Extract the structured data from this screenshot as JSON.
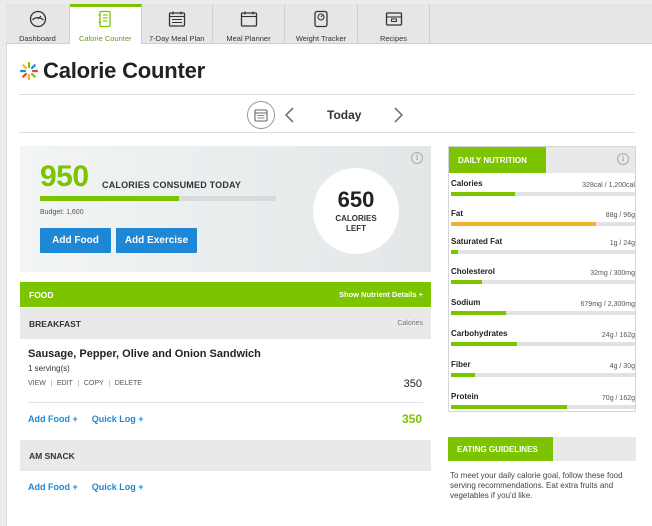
{
  "tabs": [
    {
      "label": "Dashboard",
      "icon": "dashboard-icon"
    },
    {
      "label": "Calorie Counter",
      "icon": "notebook-icon"
    },
    {
      "label": "7-Day Meal Plan",
      "icon": "calendar-week-icon"
    },
    {
      "label": "Meal Planner",
      "icon": "calendar-icon"
    },
    {
      "label": "Weight Tracker",
      "icon": "scale-icon"
    },
    {
      "label": "Recipes",
      "icon": "recipe-box-icon"
    }
  ],
  "active_tab": "Calorie Counter",
  "page": {
    "title": "Calorie Counter"
  },
  "date_nav": {
    "label": "Today"
  },
  "summary": {
    "consumed": "950",
    "consumed_label": "CALORIES CONSUMED TODAY",
    "budget": "Budget: 1,600",
    "left": "650",
    "left_label": "CALORIES LEFT",
    "progress_fraction": 0.59,
    "add_food": "Add Food",
    "add_exercise": "Add Exercise"
  },
  "food": {
    "header": "FOOD",
    "show_details": "Show Nutrient Details +",
    "breakfast": {
      "title": "BREAKFAST",
      "calories_header": "Calories",
      "item": {
        "name": "Sausage, Pepper, Olive and Onion Sandwich",
        "serving": "1 serving(s)",
        "actions": [
          "VIEW",
          "EDIT",
          "COPY",
          "DELETE"
        ],
        "calories": "350"
      },
      "add_food": "Add Food +",
      "quick_log": "Quick Log +",
      "total": "350"
    },
    "snack": {
      "title": "AM SNACK",
      "add_food": "Add Food +",
      "quick_log": "Quick Log +"
    }
  },
  "nutrition": {
    "header": "DAILY NUTRITION",
    "rows": [
      {
        "name": "Calories",
        "value": "328cal / 1,200cal",
        "fraction": 0.35,
        "color": "#7cc400"
      },
      {
        "name": "Fat",
        "value": "88g / 96g",
        "fraction": 0.79,
        "color": "#f0b323"
      },
      {
        "name": "Saturated Fat",
        "value": "1g / 24g",
        "fraction": 0.04,
        "color": "#7cc400"
      },
      {
        "name": "Cholesterol",
        "value": "32mg / 300mg",
        "fraction": 0.17,
        "color": "#7cc400"
      },
      {
        "name": "Sodium",
        "value": "679mg / 2,300mg",
        "fraction": 0.3,
        "color": "#7cc400"
      },
      {
        "name": "Carbohydrates",
        "value": "24g / 162g",
        "fraction": 0.36,
        "color": "#7cc400"
      },
      {
        "name": "Fiber",
        "value": "4g / 30g",
        "fraction": 0.13,
        "color": "#7cc400"
      },
      {
        "name": "Protein",
        "value": "70g / 162g",
        "fraction": 0.63,
        "color": "#7cc400"
      }
    ]
  },
  "guidelines": {
    "header": "EATING GUIDELINES",
    "text": "To meet your daily calorie goal, follow these food serving recommendations. Eat extra fruits and vegetables if you'd like."
  },
  "colors": {
    "accent": "#7cc400",
    "link": "#1e88d6",
    "warning": "#f0b323"
  }
}
